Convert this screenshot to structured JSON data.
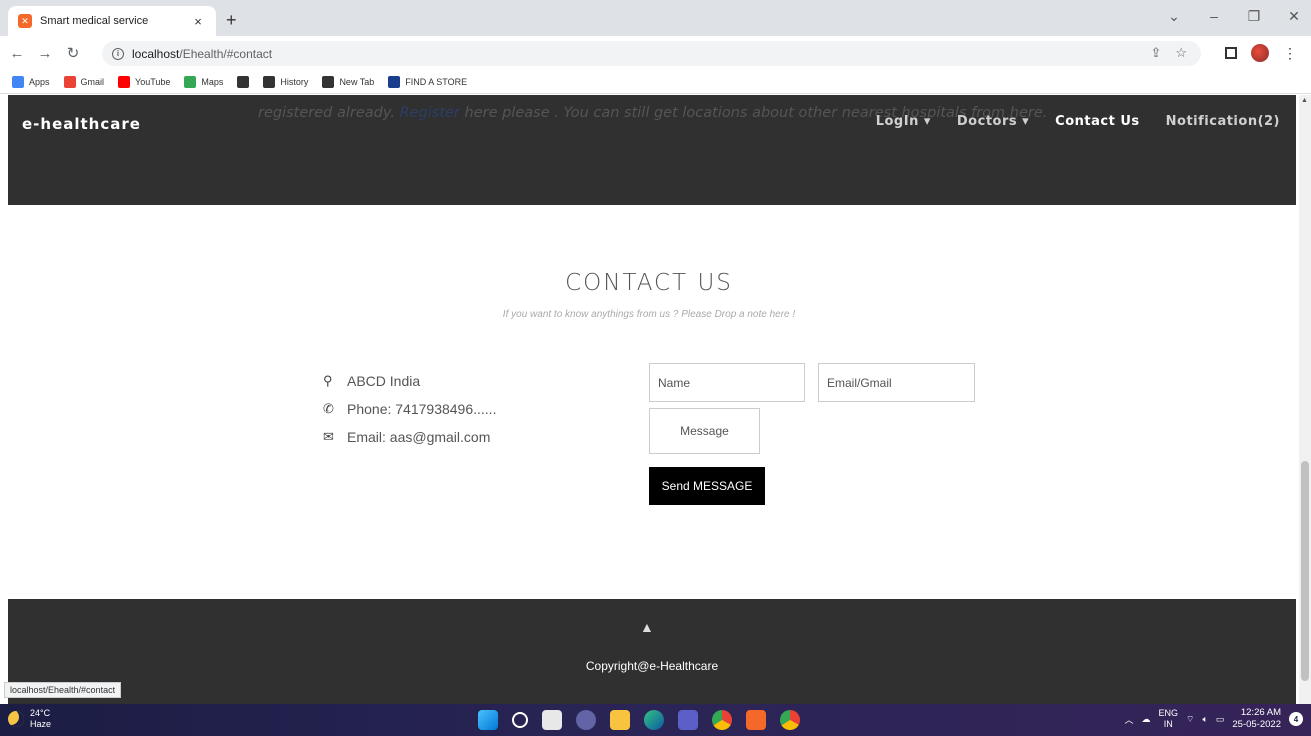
{
  "browser": {
    "tab_title": "Smart medical service",
    "tab_close": "×",
    "new_tab": "+",
    "url_host": "localhost",
    "url_path": "/Ehealth/#contact",
    "status_url": "localhost/Ehealth/#contact",
    "bookmarks": [
      {
        "label": "Apps",
        "icon": "apps-icon",
        "color": "#4285f4"
      },
      {
        "label": "Gmail",
        "icon": "gmail-icon",
        "color": "#ea4335"
      },
      {
        "label": "YouTube",
        "icon": "youtube-icon",
        "color": "#ff0000"
      },
      {
        "label": "Maps",
        "icon": "maps-icon",
        "color": "#34a853"
      },
      {
        "label": "",
        "icon": "globe-icon",
        "color": "#333333"
      },
      {
        "label": "History",
        "icon": "history-icon",
        "color": "#333333"
      },
      {
        "label": "New Tab",
        "icon": "globe-icon",
        "color": "#333333"
      },
      {
        "label": "FIND A STORE",
        "icon": "jio-icon",
        "color": "#1a3e8c"
      }
    ]
  },
  "site": {
    "brand": "e-healthcare",
    "ghost_text_pre": "registered already.",
    "ghost_text_link": "Register",
    "ghost_text_post": " here please . You can still get locations about other nearest hospitals from here.",
    "nav": [
      {
        "label": "LogIn ▾",
        "active": false
      },
      {
        "label": "Doctors ▾",
        "active": false
      },
      {
        "label": "Contact Us",
        "active": true
      },
      {
        "label": "Notification(2)",
        "active": false
      }
    ]
  },
  "contact": {
    "title": "CONTACT US",
    "subtitle": "If you want to know anythings from us ? Please Drop a note here !",
    "address": "ABCD India",
    "phone": "Phone: 7417938496......",
    "email": "Email: aas@gmail.com",
    "name_placeholder": "Name",
    "email_placeholder": "Email/Gmail",
    "message_placeholder": "Message",
    "send_label": "Send MESSAGE"
  },
  "footer": {
    "copyright": "Copyright@e-Healthcare"
  },
  "taskbar": {
    "temp": "24°C",
    "weather": "Haze",
    "lang_top": "ENG",
    "lang_bottom": "IN",
    "time": "12:26 AM",
    "date": "25-05-2022",
    "notifications": "4"
  }
}
